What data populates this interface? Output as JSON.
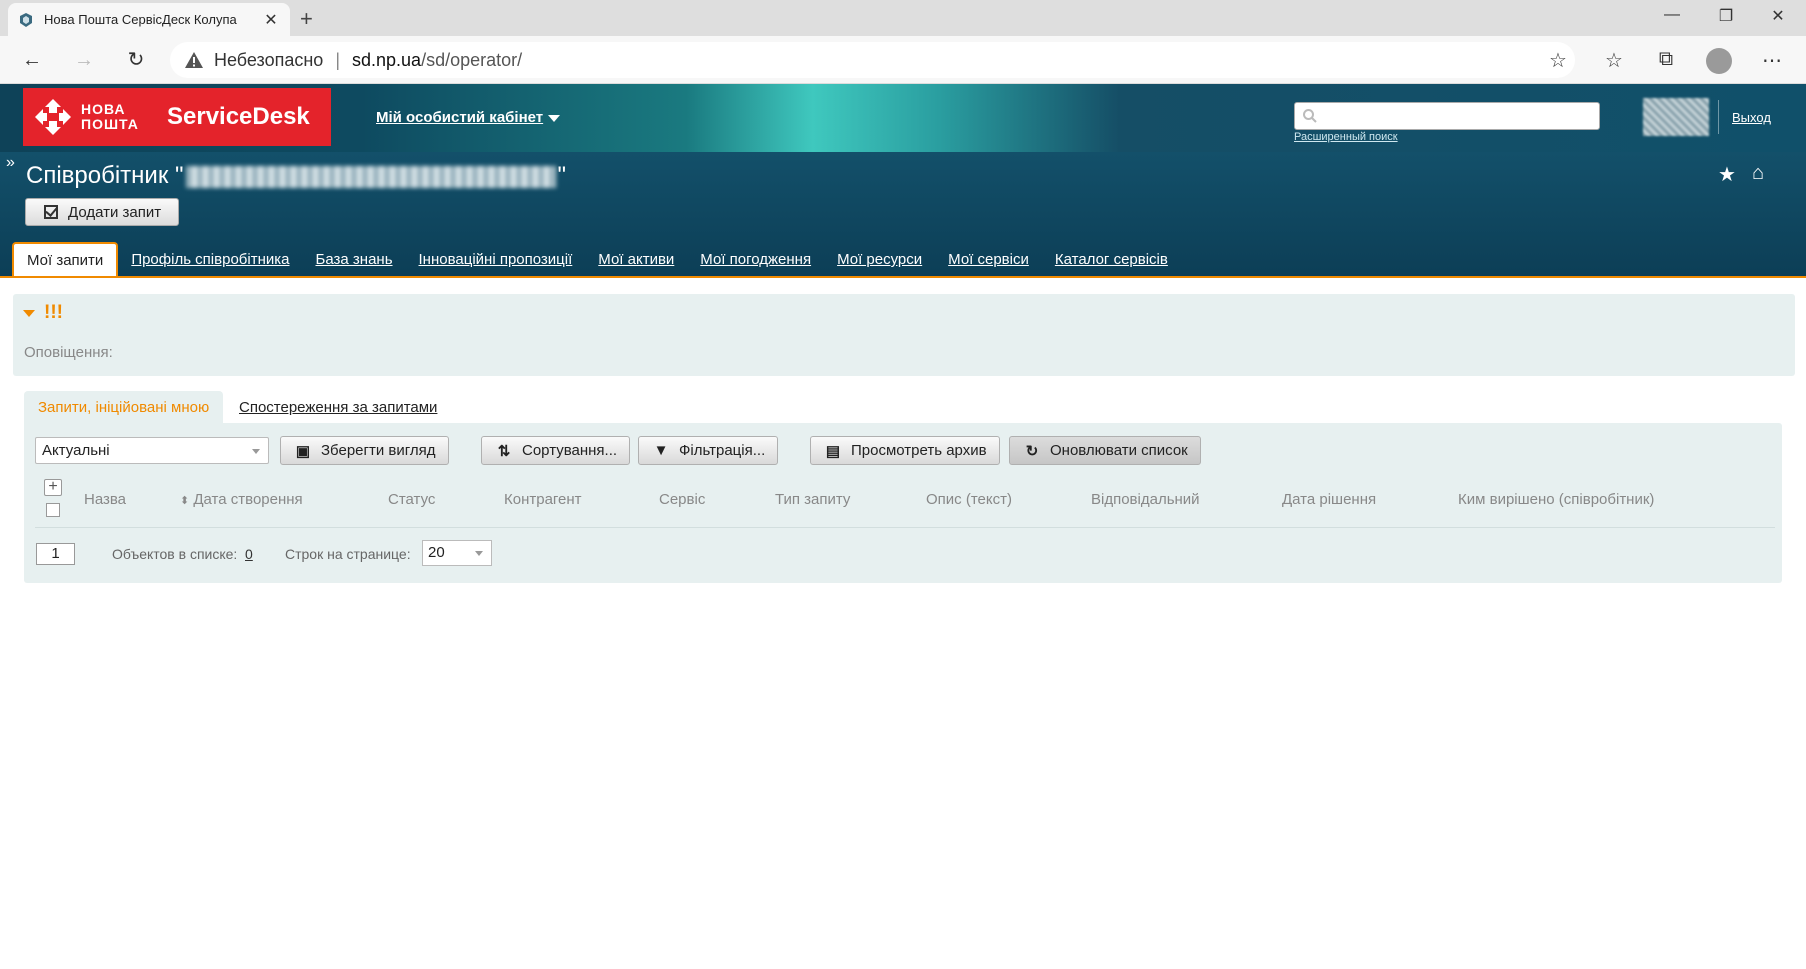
{
  "browser": {
    "tab_title": "Нова Пошта СервісДеск Колупа",
    "security_label": "Небезопасно",
    "url_host": "sd.np.ua",
    "url_path": "/sd/operator/"
  },
  "header": {
    "logo_text": "НОВА ПОШТА",
    "product_name": "ServiceDesk",
    "cabinet_label": "Мій особистий кабінет",
    "advanced_search": "Расширенный поиск",
    "logout": "Выход",
    "page_title_prefix": "Співробітник \"",
    "page_title_suffix": "\"",
    "add_request": "Додати запит"
  },
  "nav": {
    "tabs": [
      {
        "label": "Мої запити"
      },
      {
        "label": "Профіль співробітника"
      },
      {
        "label": "База знань"
      },
      {
        "label": "Інноваційні пропозиції"
      },
      {
        "label": "Мої активи"
      },
      {
        "label": "Мої погодження"
      },
      {
        "label": "Мої ресурси"
      },
      {
        "label": "Мої сервіси"
      },
      {
        "label": "Каталог сервісів"
      }
    ]
  },
  "notifications": {
    "marker": "!!!",
    "label": "Оповіщення:"
  },
  "subtabs": {
    "initiated": "Запити, ініційовані мною",
    "watching": "Спостереження за запитами"
  },
  "toolbar": {
    "view_value": "Актуальні",
    "save_view": "Зберегти вигляд",
    "sorting": "Сортування...",
    "filtering": "Фільтрація...",
    "archive": "Просмотреть архив",
    "refresh": "Оновлювати список"
  },
  "table": {
    "columns": [
      {
        "label": "Назва"
      },
      {
        "label": "Дата створення"
      },
      {
        "label": "Статус"
      },
      {
        "label": "Контрагент"
      },
      {
        "label": "Сервіс"
      },
      {
        "label": "Тип запиту"
      },
      {
        "label": "Опис (текст)"
      },
      {
        "label": "Відповідальний"
      },
      {
        "label": "Дата рішення"
      },
      {
        "label": "Ким вирішено (співробітник)"
      }
    ]
  },
  "footer": {
    "page": "1",
    "objects_label": "Объектов в списке:",
    "objects_count": "0",
    "rows_label": "Строк на странице:",
    "rows_value": "20"
  },
  "colors": {
    "accent": "#f08a00",
    "brand_red": "#e4232b",
    "header_dark": "#0e4258"
  }
}
